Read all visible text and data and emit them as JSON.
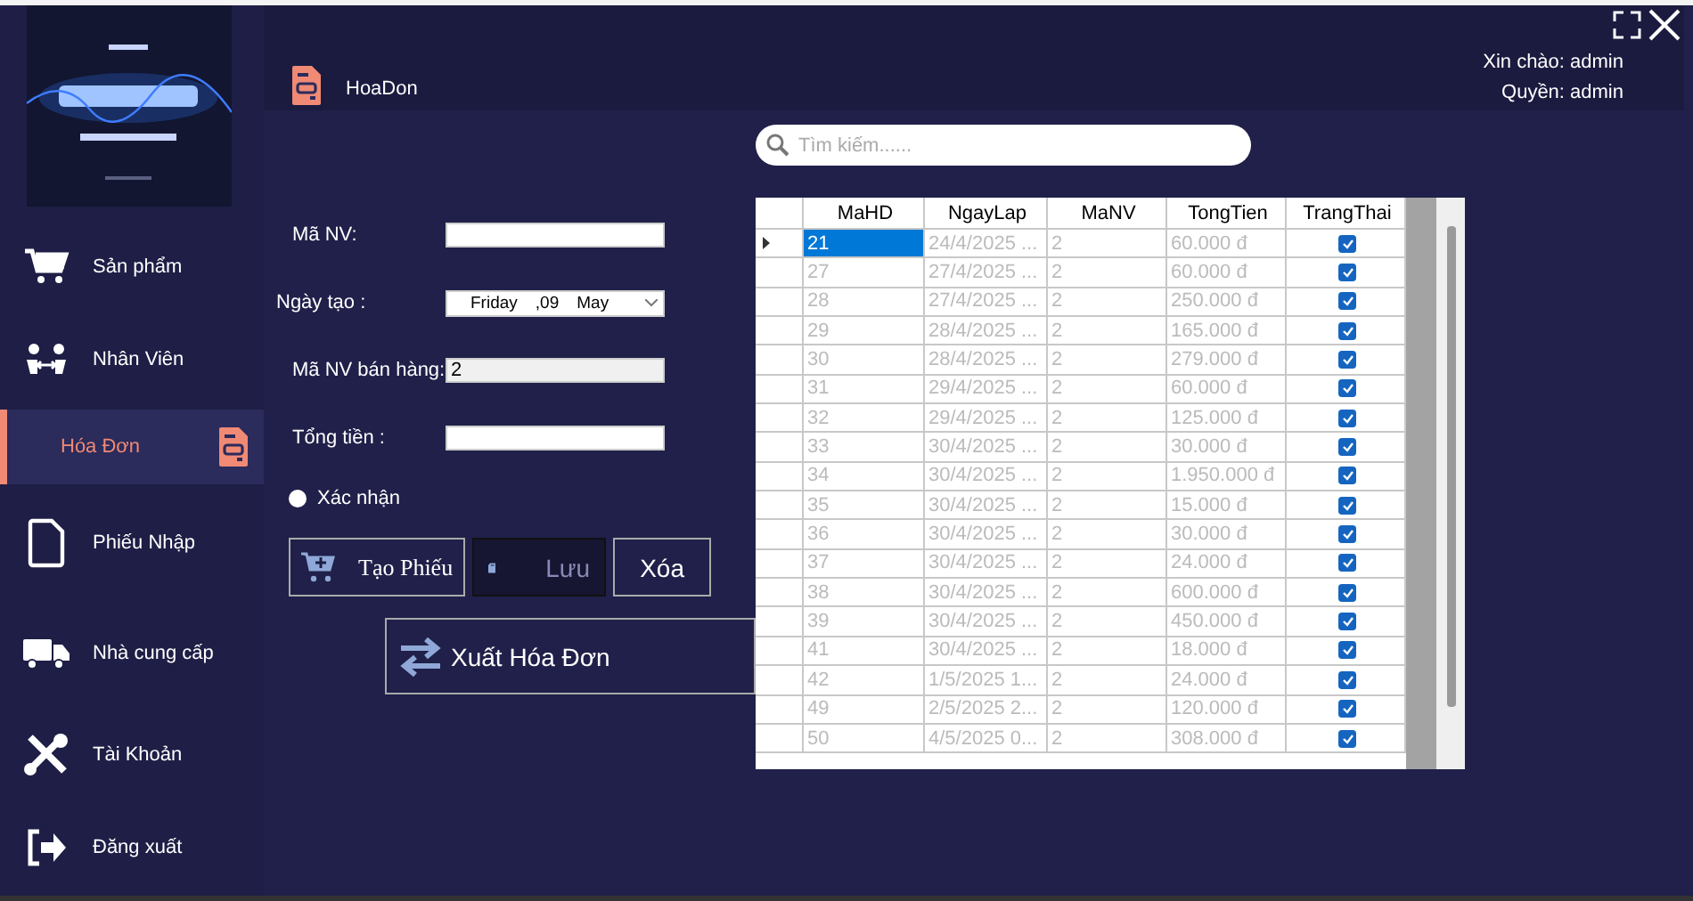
{
  "sidebar": {
    "items": [
      {
        "label": "Sản phẩm",
        "selected": false
      },
      {
        "label": "Nhân Viên",
        "selected": false
      },
      {
        "label": "Hóa Đơn",
        "selected": true
      },
      {
        "label": "Phiếu Nhập",
        "selected": false
      },
      {
        "label": "Nhà cung cấp",
        "selected": false
      },
      {
        "label": "Tài Khoản",
        "selected": false
      },
      {
        "label": "Đăng xuất",
        "selected": false
      }
    ]
  },
  "header": {
    "title": "HoaDon",
    "greeting": "Xin chào: admin",
    "role": "Quyền: admin"
  },
  "form": {
    "fields": [
      {
        "kind": "text",
        "label": "Mã NV:"
      },
      {
        "kind": "date",
        "label": "Ngày tạo :",
        "parts": [
          "Friday",
          ",09",
          "May"
        ]
      },
      {
        "kind": "text",
        "label": "Mã NV bán hàng:",
        "value": "2"
      },
      {
        "kind": "text",
        "label": "Tổng tiền :"
      }
    ],
    "confirm": {
      "label": "Xác nhận",
      "checked": false
    },
    "buttons": [
      {
        "label": "Tạo Phiếu",
        "kind": "outline"
      },
      {
        "label": "Lưu",
        "kind": "dark"
      },
      {
        "label": "Xóa",
        "kind": "outline"
      }
    ],
    "export_button": {
      "label": "Xuất Hóa Đơn"
    }
  },
  "search": {
    "placeholder": "Tìm kiếm......"
  },
  "table": {
    "columns": [
      "MaHD",
      "NgayLap",
      "MaNV",
      "TongTien",
      "TrangThai"
    ],
    "rows": [
      {
        "cells": [
          "21",
          "24/4/2025 ...",
          "2",
          "60.000 đ"
        ],
        "checked": true,
        "selected": true
      },
      {
        "cells": [
          "27",
          "27/4/2025 ...",
          "2",
          "60.000 đ"
        ],
        "checked": true,
        "selected": false
      },
      {
        "cells": [
          "28",
          "27/4/2025 ...",
          "2",
          "250.000 đ"
        ],
        "checked": true,
        "selected": false
      },
      {
        "cells": [
          "29",
          "28/4/2025 ...",
          "2",
          "165.000 đ"
        ],
        "checked": true,
        "selected": false
      },
      {
        "cells": [
          "30",
          "28/4/2025 ...",
          "2",
          "279.000 đ"
        ],
        "checked": true,
        "selected": false
      },
      {
        "cells": [
          "31",
          "29/4/2025 ...",
          "2",
          "60.000 đ"
        ],
        "checked": true,
        "selected": false
      },
      {
        "cells": [
          "32",
          "29/4/2025 ...",
          "2",
          "125.000 đ"
        ],
        "checked": true,
        "selected": false
      },
      {
        "cells": [
          "33",
          "30/4/2025 ...",
          "2",
          "30.000 đ"
        ],
        "checked": true,
        "selected": false
      },
      {
        "cells": [
          "34",
          "30/4/2025 ...",
          "2",
          "1.950.000 đ"
        ],
        "checked": true,
        "selected": false
      },
      {
        "cells": [
          "35",
          "30/4/2025 ...",
          "2",
          "15.000 đ"
        ],
        "checked": true,
        "selected": false
      },
      {
        "cells": [
          "36",
          "30/4/2025 ...",
          "2",
          "30.000 đ"
        ],
        "checked": true,
        "selected": false
      },
      {
        "cells": [
          "37",
          "30/4/2025 ...",
          "2",
          "24.000 đ"
        ],
        "checked": true,
        "selected": false
      },
      {
        "cells": [
          "38",
          "30/4/2025 ...",
          "2",
          "600.000 đ"
        ],
        "checked": true,
        "selected": false
      },
      {
        "cells": [
          "39",
          "30/4/2025 ...",
          "2",
          "450.000 đ"
        ],
        "checked": true,
        "selected": false
      },
      {
        "cells": [
          "41",
          "30/4/2025 ...",
          "2",
          "18.000 đ"
        ],
        "checked": true,
        "selected": false
      },
      {
        "cells": [
          "42",
          "1/5/2025 1...",
          "2",
          "24.000 đ"
        ],
        "checked": true,
        "selected": false
      },
      {
        "cells": [
          "49",
          "2/5/2025 2...",
          "2",
          "120.000 đ"
        ],
        "checked": true,
        "selected": false
      },
      {
        "cells": [
          "50",
          "4/5/2025 0...",
          "2",
          "308.000 đ"
        ],
        "checked": true,
        "selected": false
      }
    ]
  }
}
